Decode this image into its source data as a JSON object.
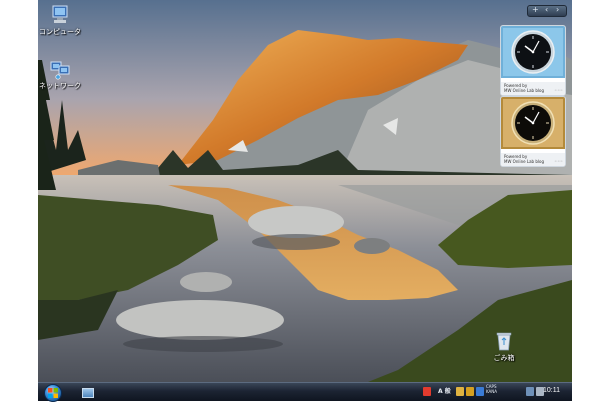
{
  "desktop_icons": [
    {
      "label": "コンピュータ",
      "icon": "computer-icon"
    },
    {
      "label": "ネットワーク",
      "icon": "network-icon"
    },
    {
      "label": "ごみ箱",
      "icon": "recycle-bin-icon"
    }
  ],
  "gadgets": [
    {
      "caption": "Powered by\nMW Online Lab blog",
      "theme": "blue-clock"
    },
    {
      "caption": "Powered by\nMW Online Lab blog",
      "theme": "gold-clock"
    }
  ],
  "taskbar": {
    "ime_label": "A 般",
    "caps_label": "CAPS\nKANA",
    "clock_time": "10:11"
  },
  "colors": {
    "taskbar_top": "#3a4658",
    "taskbar_bottom": "#0f1520",
    "sky_top": "#57708f",
    "sky_bottom": "#f3a86b",
    "mountain_light": "#e9a046"
  }
}
